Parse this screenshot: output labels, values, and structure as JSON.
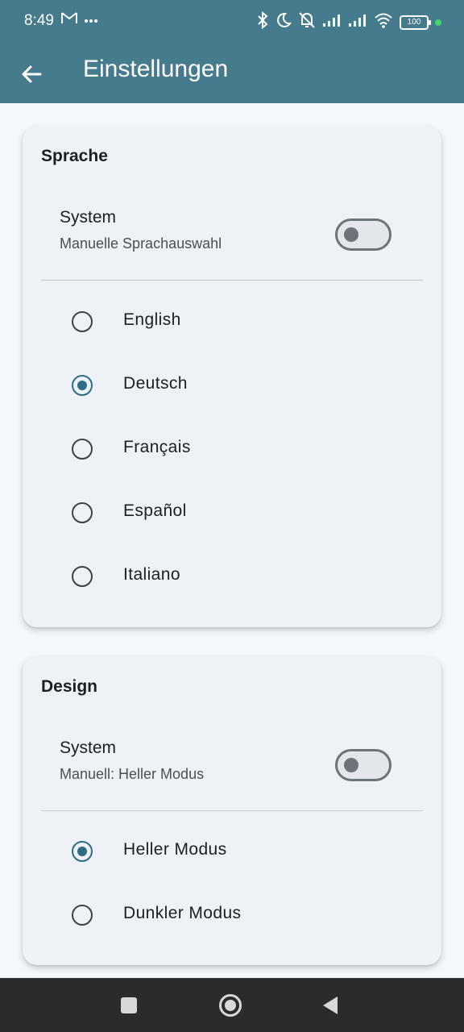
{
  "status_bar": {
    "time": "8:49",
    "left_icons": [
      "gmail-icon",
      "more-dots-icon"
    ],
    "right_icons": [
      "bluetooth-icon",
      "moon-icon",
      "bell-muted-icon",
      "signal-icon",
      "signal-icon",
      "wifi-icon"
    ],
    "battery": "100"
  },
  "app_bar": {
    "title": "Einstellungen",
    "back_icon": "arrow-back-icon"
  },
  "language_card": {
    "title": "Sprache",
    "system_label": "System",
    "system_subtitle": "Manuelle Sprachauswahl",
    "system_enabled": false,
    "options": [
      {
        "label": "English",
        "selected": false
      },
      {
        "label": "Deutsch",
        "selected": true
      },
      {
        "label": "Français",
        "selected": false
      },
      {
        "label": "Español",
        "selected": false
      },
      {
        "label": "Italiano",
        "selected": false
      }
    ]
  },
  "design_card": {
    "title": "Design",
    "system_label": "System",
    "system_subtitle": "Manuell: Heller Modus",
    "system_enabled": false,
    "options": [
      {
        "label": "Heller Modus",
        "selected": true
      },
      {
        "label": "Dunkler Modus",
        "selected": false
      }
    ]
  },
  "nav_bar": {
    "buttons": [
      "recents-square-icon",
      "home-circle-icon",
      "back-triangle-icon"
    ]
  },
  "colors": {
    "primary": "#457b8c",
    "accent": "#2f6e82",
    "card": "#eef2f6",
    "background": "#f4f8fc"
  }
}
